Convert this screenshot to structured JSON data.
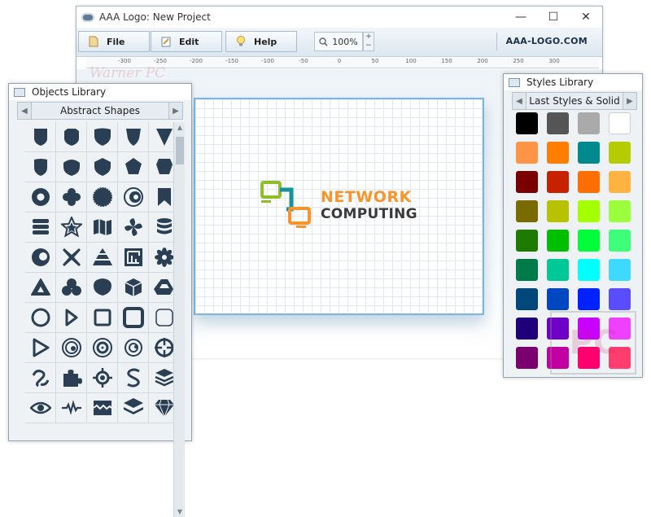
{
  "window": {
    "title": "AAA Logo: New Project",
    "controls": {
      "minimize": "—",
      "maximize": "☐",
      "close": "✕"
    }
  },
  "toolbar": {
    "file": "File",
    "edit": "Edit",
    "help": "Help",
    "zoom": "100%",
    "zoom_up": "+",
    "zoom_down": "−",
    "brand": "AAA-LOGO.COM"
  },
  "ruler": [
    "-300",
    "-250",
    "-200",
    "-150",
    "-100",
    "-50",
    "0",
    "50",
    "100",
    "150",
    "200",
    "250",
    "300"
  ],
  "canvas": {
    "logo_line1": "NETWORK",
    "logo_line2": "COMPUTING",
    "colors": {
      "primary": "#f7942c",
      "dark": "#3a3a3a",
      "green": "#8fbf26",
      "teal": "#17919a"
    }
  },
  "objects_library": {
    "title": "Objects Library",
    "category": "Abstract Shapes",
    "prev": "◀",
    "next": "▶",
    "icon_color": "#2b3f54",
    "icons": [
      "shield-1-icon",
      "shield-2-icon",
      "shield-3-icon",
      "shield-4-icon",
      "shield-5-icon",
      "shield-6-icon",
      "shield-7-icon",
      "shield-8-icon",
      "pentagon-icon",
      "shield-10-icon",
      "ring-icon",
      "flower-icon",
      "badge-icon",
      "spiral-icon",
      "bookmark-icon",
      "stack-icon",
      "star-icon",
      "map-icon",
      "pinwheel-icon",
      "database-icon",
      "donut-icon",
      "cross-icon",
      "pyramid-icon",
      "maze-icon",
      "petal-icon",
      "triangle-rounded-icon",
      "clover-icon",
      "shell-icon",
      "cube-icon",
      "drive-icon",
      "circle-outline-icon",
      "play-outline-icon",
      "square-outline-icon",
      "square-thick-icon",
      "square-thin-icon",
      "triangle-outline-icon",
      "swirl-icon",
      "target-icon",
      "crosshair-icon",
      "aim-icon",
      "loop-icon",
      "puzzle-icon",
      "gear-target-icon",
      "s-curve-icon",
      "layers-icon",
      "eye-icon",
      "pulse-icon",
      "wave-box-icon",
      "layers-stack-icon",
      "diamond-icon"
    ]
  },
  "styles_library": {
    "title": "Styles Library",
    "category": "Last Styles & Solid",
    "prev": "◀",
    "next": "▶",
    "colors": [
      "#000000",
      "#555555",
      "#aaaaaa",
      "#ffffff",
      "#ff9447",
      "#ff7e00",
      "#008a8e",
      "#b5cc00",
      "#7a0000",
      "#c62200",
      "#ff6e00",
      "#ffb340",
      "#7a6b00",
      "#b8c200",
      "#a4ff00",
      "#9cff3d",
      "#1f7a00",
      "#00bf00",
      "#00ff3a",
      "#3dff7a",
      "#007a48",
      "#00c896",
      "#00ffff",
      "#3dd9ff",
      "#00487a",
      "#0048c2",
      "#0022ff",
      "#5a4dff",
      "#20007a",
      "#6e00c8",
      "#c800ff",
      "#f040ff",
      "#7a0070",
      "#c200a2",
      "#ff006e",
      "#ff3d6e"
    ]
  },
  "watermark": {
    "letters": "PC",
    "text": "Warner PC"
  }
}
